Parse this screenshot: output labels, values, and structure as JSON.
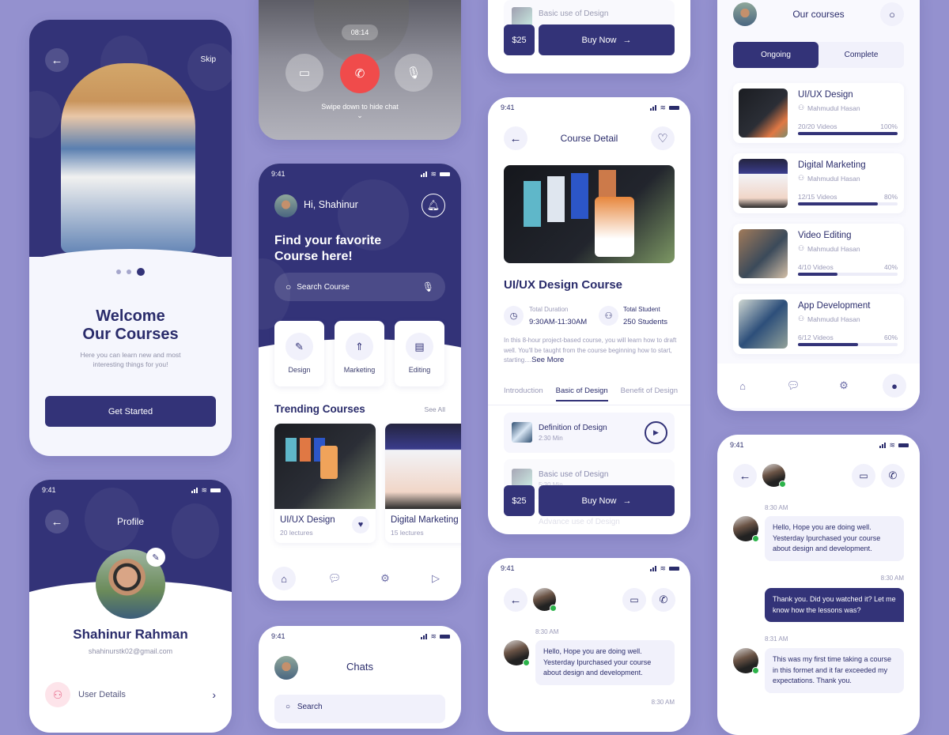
{
  "colors": {
    "primary": "#333378",
    "background": "#9491cf",
    "surface": "#f1f1fb",
    "danger": "#f04b4b",
    "online": "#2cb34a"
  },
  "status_time": "9:41",
  "onboarding": {
    "skip": "Skip",
    "title_line1": "Welcome",
    "title_line2": "Our Courses",
    "subtitle_line1": "Here you can learn new and most",
    "subtitle_line2": "interesting things for you!",
    "button": "Get Started",
    "page_dots": 3,
    "active_dot": 3
  },
  "call": {
    "timer": "08:14",
    "hint": "Swipe down to hide chat"
  },
  "home": {
    "greeting": "Hi, Shahinur",
    "headline_line1": "Find your favorite",
    "headline_line2": "Course here!",
    "search_placeholder": "Search Course",
    "categories": [
      {
        "label": "Design",
        "icon": "brush-icon"
      },
      {
        "label": "Marketing",
        "icon": "rocket-icon"
      },
      {
        "label": "Editing",
        "icon": "clipboard-icon"
      }
    ],
    "trending_title": "Trending Courses",
    "see_all": "See All",
    "trending": [
      {
        "title": "UI/UX Design",
        "meta": "20 lectures"
      },
      {
        "title": "Digital Marketing",
        "meta": "15 lectures"
      }
    ]
  },
  "detail": {
    "title": "Course Detail",
    "course_title": "UI/UX Design Course",
    "duration_label": "Total Duration",
    "duration_value": "9:30AM-11:30AM",
    "students_label": "Total Student",
    "students_value": "250 Students",
    "description": "In this 8-hour project-based course, you will learn how to draft well. You'll be taught from the course beginning how to start, starting....",
    "see_more": "See More",
    "tabs": [
      "Introduction",
      "Basic of Design",
      "Benefit of Design"
    ],
    "active_tab": 1,
    "lessons": [
      {
        "title": "Definition of Design",
        "meta": "2:30 Min"
      },
      {
        "title": "Basic use of Design",
        "meta": "5:30 Min"
      },
      {
        "title": "Advance use of Design",
        "meta": ""
      }
    ],
    "price": "$25",
    "buy": "Buy Now"
  },
  "courses": {
    "title": "Our courses",
    "tabs": [
      "Ongoing",
      "Complete"
    ],
    "active_tab": 0,
    "items": [
      {
        "title": "UI/UX Design",
        "author": "Mahmudul Hasan",
        "videos": "20/20 Videos",
        "percent": "100%",
        "progress": 1.0
      },
      {
        "title": "Digital Marketing",
        "author": "Mahmudul Hasan",
        "videos": "12/15 Videos",
        "percent": "80%",
        "progress": 0.8
      },
      {
        "title": "Video Editing",
        "author": "Mahmudul Hasan",
        "videos": "4/10 Videos",
        "percent": "40%",
        "progress": 0.4
      },
      {
        "title": "App Development",
        "author": "Mahmudul Hasan",
        "videos": "6/12 Videos",
        "percent": "60%",
        "progress": 0.6
      }
    ]
  },
  "profile": {
    "title": "Profile",
    "name": "Shahinur Rahman",
    "email": "shahinurstk02@gmail.com",
    "menu": [
      {
        "label": "User Details"
      }
    ]
  },
  "chats": {
    "title": "Chats",
    "search_placeholder": "Search"
  },
  "chat": {
    "messages": [
      {
        "time": "8:30 AM",
        "from": "them",
        "text": "Hello, Hope you are doing well. Yesterday Ipurchased your course about design and development."
      },
      {
        "time": "8:30 AM",
        "from": "me",
        "text": "Thank you. Did you watched it? Let me know  how the lessons was?"
      },
      {
        "time": "8:31 AM",
        "from": "them",
        "text": "This was my first time taking a course in this formet and it far exceeded my expectations. Thank you."
      }
    ]
  }
}
